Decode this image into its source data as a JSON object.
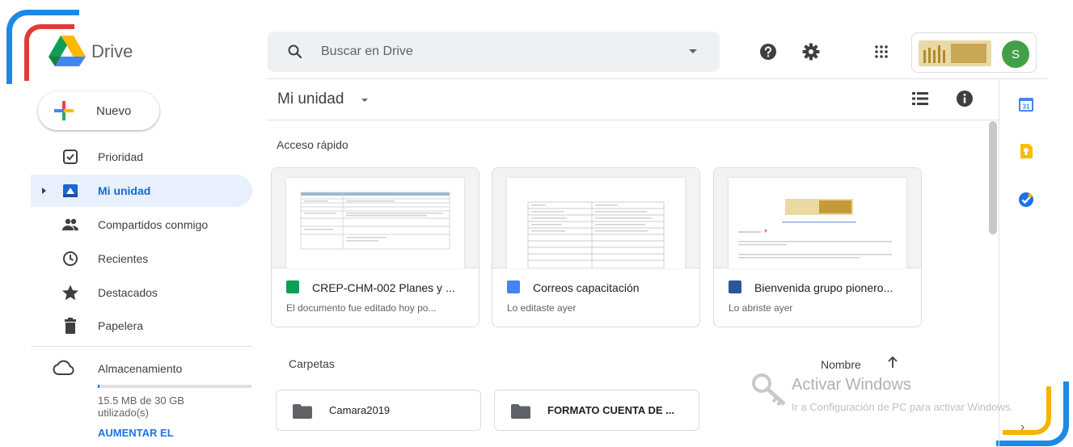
{
  "header": {
    "app_name": "Drive",
    "search_placeholder": "Buscar en Drive",
    "icons": [
      "help-icon",
      "settings-icon",
      "apps-grid-icon"
    ],
    "avatar_letter": "S"
  },
  "sidebar": {
    "new_label": "Nuevo",
    "items": [
      {
        "label": "Prioridad",
        "icon": "priority-check-icon"
      },
      {
        "label": "Mi unidad",
        "icon": "my-drive-icon",
        "active": true
      },
      {
        "label": "Compartidos conmigo",
        "icon": "people-icon"
      },
      {
        "label": "Recientes",
        "icon": "clock-icon"
      },
      {
        "label": "Destacados",
        "icon": "star-icon"
      },
      {
        "label": "Papelera",
        "icon": "trash-icon"
      }
    ],
    "storage": {
      "label": "Almacenamiento",
      "used_text": "15.5 MB de 30 GB utilizado(s)",
      "used_fraction": 0.0005,
      "upgrade_label": "AUMENTAR EL"
    }
  },
  "main": {
    "title": "Mi unidad",
    "quick_access_title": "Acceso rápido",
    "quick_access": [
      {
        "name": "CREP-CHM-002 Planes y ...",
        "subtitle": "El documento fue editado hoy po...",
        "type": "sheets",
        "color": "#0f9d58",
        "glyph": "+"
      },
      {
        "name": "Correos capacitación",
        "subtitle": "Lo editaste ayer",
        "type": "docs",
        "color": "#4285f4",
        "glyph": "≡"
      },
      {
        "name": "Bienvenida grupo pionero...",
        "subtitle": "Lo abriste ayer",
        "type": "word",
        "color": "#2b579a",
        "glyph": "W"
      }
    ],
    "folders_title": "Carpetas",
    "sort_label": "Nombre",
    "folders": [
      {
        "name": "Camara2019"
      },
      {
        "name": "FORMATO CUENTA DE ..."
      }
    ]
  },
  "right_panel": {
    "icons": [
      "calendar-icon",
      "keep-icon",
      "tasks-icon"
    ],
    "calendar_day": "31",
    "expand_glyph": "›"
  },
  "watermark": {
    "title": "Activar Windows",
    "subtitle": "Ir a Configuración de PC para activar Windows."
  },
  "colors": {
    "accent_blue": "#1a73e8",
    "active_bg": "#e8f0fe",
    "avatar_green": "#43a047"
  }
}
